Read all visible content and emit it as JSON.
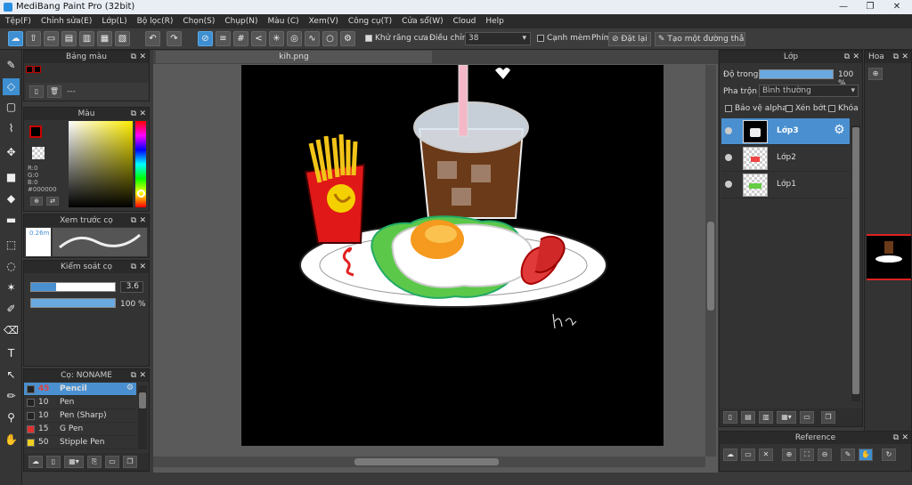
{
  "window": {
    "title": "MediBang Paint Pro (32bit)",
    "controls": [
      "—",
      "❐",
      "✕"
    ]
  },
  "menu": [
    "Tệp(F)",
    "Chỉnh sửa(E)",
    "Lớp(L)",
    "Bộ lọc(R)",
    "Chọn(S)",
    "Chụp(N)",
    "Màu (C)",
    "Xem(V)",
    "Công cụ(T)",
    "Cửa sổ(W)",
    "Cloud",
    "Help"
  ],
  "toolbar": {
    "antialias_label": "Khử răng cưa",
    "adjust_label": "Điều chỉnh",
    "adjust_value": "38",
    "edge_label": "Cạnh mèm",
    "key_label": "Phím",
    "reset_label": "Đặt lại",
    "line_label": "Tạo một đường thẳng"
  },
  "palette_panel": {
    "title": "Bảng màu",
    "dash": "---"
  },
  "color_panel": {
    "title": "Màu",
    "r": "R:0",
    "g": "G:0",
    "b": "B:0",
    "hex": "#000000"
  },
  "preview_panel": {
    "title": "Xem trước cọ",
    "size": "0.26m"
  },
  "brush_control": {
    "title": "Kiểm soát cọ",
    "size_value": "3.6",
    "size_fill": 0.3,
    "opacity_value": "100 %",
    "opacity_fill": 1.0
  },
  "brush_panel": {
    "title": "Cọ: NONAME",
    "items": [
      {
        "size": "45",
        "name": "Pencil",
        "color": "#222222",
        "selected": true
      },
      {
        "size": "10",
        "name": "Pen",
        "color": "#222222"
      },
      {
        "size": "10",
        "name": "Pen (Sharp)",
        "color": "#222222"
      },
      {
        "size": "15",
        "name": "G Pen",
        "color": "#e03030"
      },
      {
        "size": "50",
        "name": "Stipple Pen",
        "color": "#f0d020"
      }
    ]
  },
  "document": {
    "tab": "kih.png",
    "signature": "hai"
  },
  "layer_panel": {
    "title": "Lớp",
    "opacity_label": "Độ trong",
    "opacity_value": "100 %",
    "opacity_fill": 1.0,
    "blend_label": "Pha trộn",
    "blend_value": "Bình thường",
    "protect_alpha": "Bảo vệ alpha",
    "clip": "Xén bớt",
    "lock": "Khóa",
    "layers": [
      {
        "name": "Lớp3",
        "selected": true
      },
      {
        "name": "Lớp2"
      },
      {
        "name": "Lớp1"
      }
    ]
  },
  "navigator_panel": {
    "title": "Hoa"
  },
  "reference_panel": {
    "title": "Reference"
  },
  "colors": {
    "accent": "#3d8fd1",
    "selected": "#4a90d0",
    "canvas_bg": "#000000"
  }
}
